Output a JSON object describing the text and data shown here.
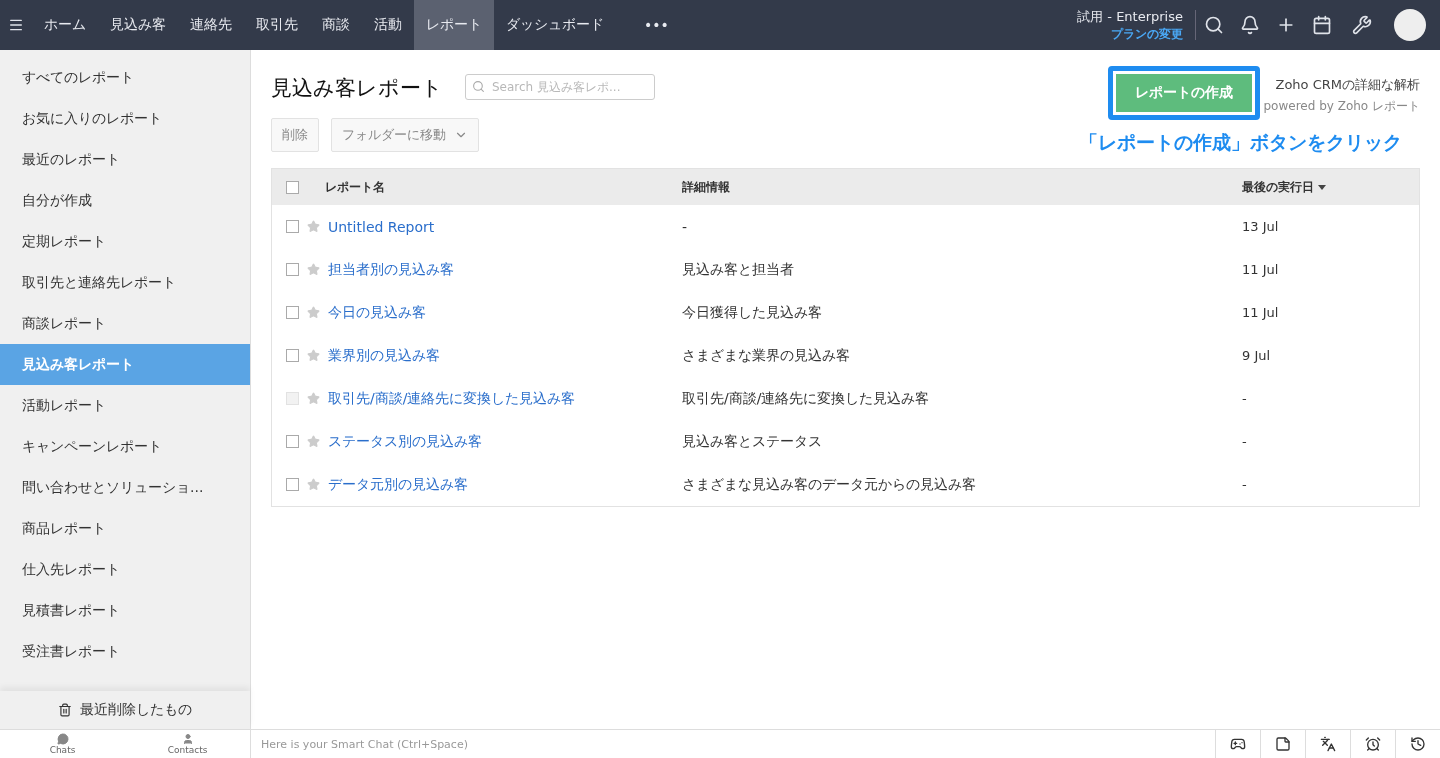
{
  "topbar": {
    "menu_items": [
      {
        "label": "ホーム",
        "selected": false
      },
      {
        "label": "見込み客",
        "selected": false
      },
      {
        "label": "連絡先",
        "selected": false
      },
      {
        "label": "取引先",
        "selected": false
      },
      {
        "label": "商談",
        "selected": false
      },
      {
        "label": "活動",
        "selected": false
      },
      {
        "label": "レポート",
        "selected": true
      },
      {
        "label": "ダッシュボード",
        "selected": false
      }
    ],
    "more": "•••",
    "plan": "試用 - Enterprise",
    "plan_link": "プランの変更"
  },
  "sidebar": {
    "items": [
      {
        "label": "すべてのレポート",
        "selected": false
      },
      {
        "label": "お気に入りのレポート",
        "selected": false
      },
      {
        "label": "最近のレポート",
        "selected": false
      },
      {
        "label": "自分が作成",
        "selected": false
      },
      {
        "label": "定期レポート",
        "selected": false
      },
      {
        "label": "取引先と連絡先レポート",
        "selected": false
      },
      {
        "label": "商談レポート",
        "selected": false
      },
      {
        "label": "見込み客レポート",
        "selected": true
      },
      {
        "label": "活動レポート",
        "selected": false
      },
      {
        "label": "キャンペーンレポート",
        "selected": false
      },
      {
        "label": "問い合わせとソリューショ...",
        "selected": false
      },
      {
        "label": "商品レポート",
        "selected": false
      },
      {
        "label": "仕入先レポート",
        "selected": false
      },
      {
        "label": "見積書レポート",
        "selected": false
      },
      {
        "label": "受注書レポート",
        "selected": false
      }
    ],
    "footer": "最近削除したもの"
  },
  "main": {
    "title": "見込み客レポート",
    "search": {
      "placeholder": "Search 見込み客レポ..."
    },
    "create_button": {
      "label": "レポートの作成",
      "highlighted": true
    },
    "promo": "Zoho CRMの詳細な解析",
    "promo_sub": "powered by Zoho レポート",
    "annotation": "「レポートの作成」ボタンをクリック",
    "actions": {
      "delete": "削除",
      "move": "フォルダーに移動"
    },
    "table": {
      "select_all_checked": false,
      "columns": [
        "レポート名",
        "詳細情報",
        "最後の実行日"
      ],
      "rows": [
        {
          "name": "Untitled Report",
          "details": "-",
          "last_run": "13 Jul",
          "disabled": false,
          "checked": false
        },
        {
          "name": "担当者別の見込み客",
          "details": "見込み客と担当者",
          "last_run": "11 Jul",
          "disabled": false,
          "checked": false
        },
        {
          "name": "今日の見込み客",
          "details": "今日獲得した見込み客",
          "last_run": "11 Jul",
          "disabled": false,
          "checked": false
        },
        {
          "name": "業界別の見込み客",
          "details": "さまざまな業界の見込み客",
          "last_run": "9 Jul",
          "disabled": false,
          "checked": false
        },
        {
          "name": "取引先/商談/連絡先に変換した見込み客",
          "details": "取引先/商談/連絡先に変換した見込み客",
          "last_run": "-",
          "disabled": true,
          "checked": false
        },
        {
          "name": "ステータス別の見込み客",
          "details": "見込み客とステータス",
          "last_run": "-",
          "disabled": false,
          "checked": false
        },
        {
          "name": "データ元別の見込み客",
          "details": "さまざまな見込み客のデータ元からの見込み客",
          "last_run": "-",
          "disabled": false,
          "checked": false
        }
      ]
    }
  },
  "bottombar": {
    "tabs": [
      "Chats",
      "Contacts"
    ],
    "chat_placeholder": "Here is your Smart Chat (Ctrl+Space)"
  }
}
